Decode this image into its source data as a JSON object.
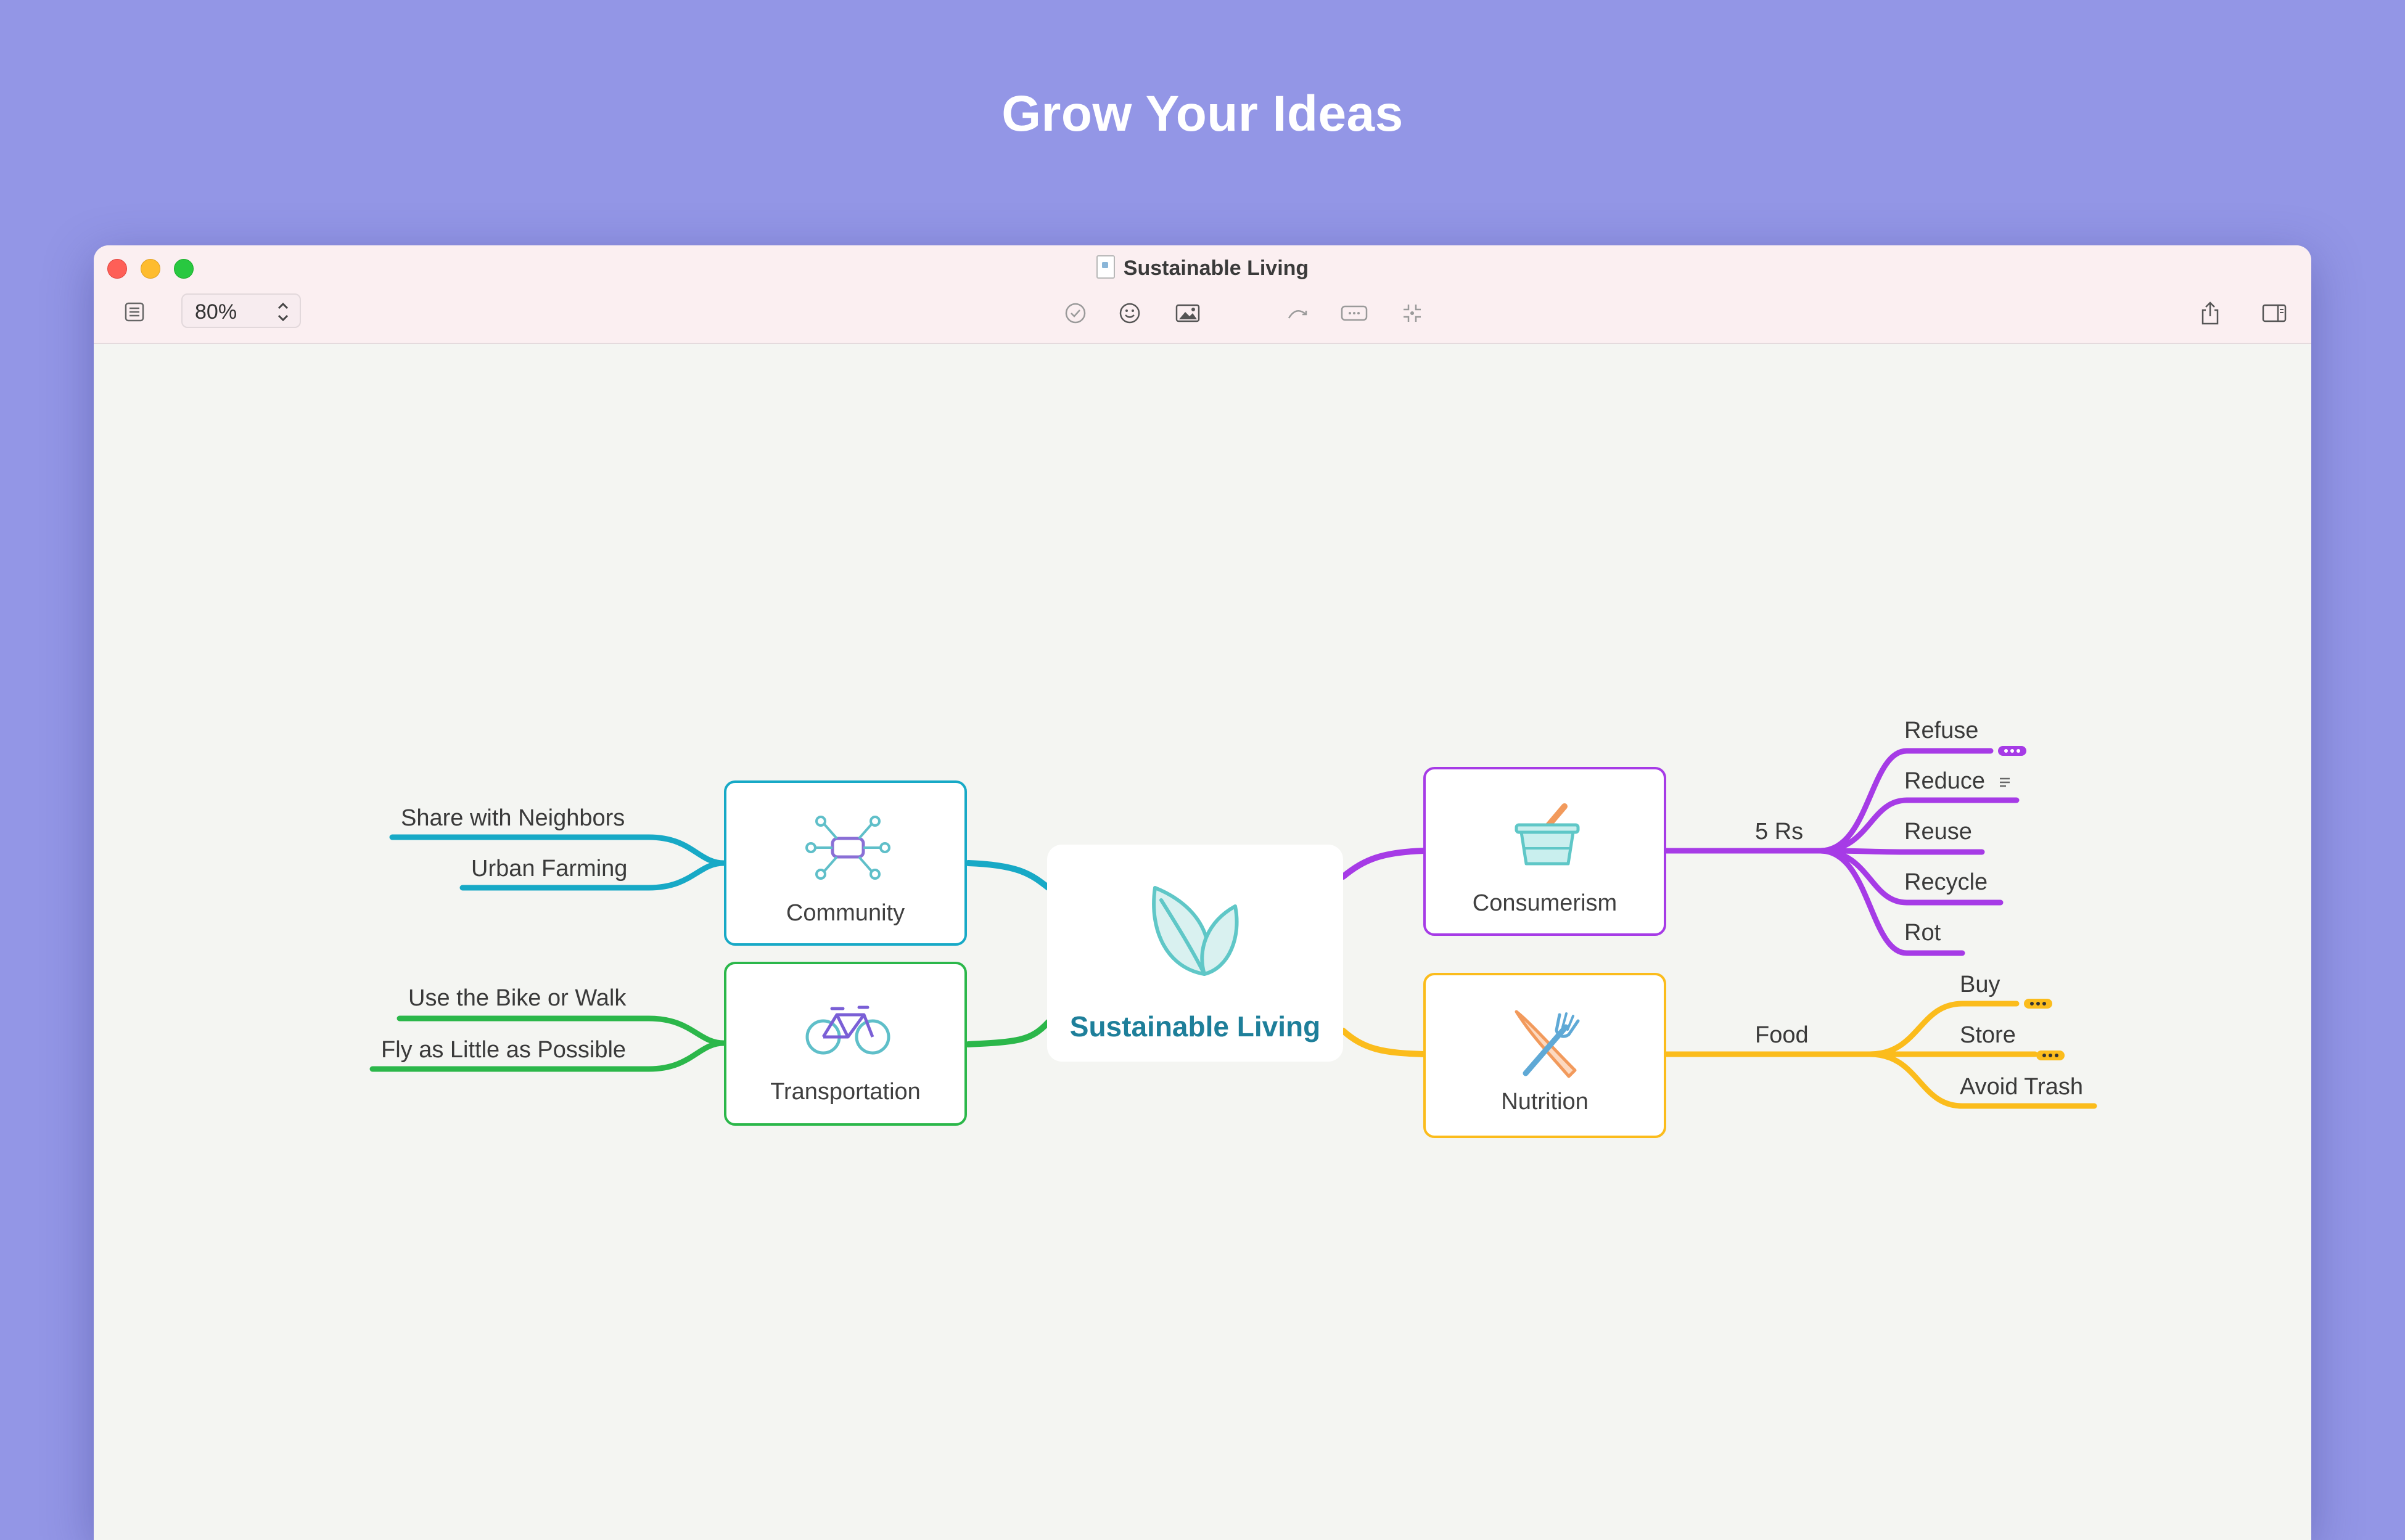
{
  "headline": "Grow Your Ideas",
  "window": {
    "title": "Sustainable Living",
    "zoom": "80%"
  },
  "toolbar": {
    "left": [
      "outline-icon"
    ],
    "center": [
      "checkbox-icon",
      "emoji-icon",
      "image-icon",
      "relation-arrow-icon",
      "callout-icon",
      "focus-icon"
    ],
    "right": [
      "share-icon",
      "sidebar-icon"
    ]
  },
  "mindmap": {
    "central": {
      "label": "Sustainable Living",
      "icon": "leaf-icon",
      "color": "#1e7f9a"
    },
    "topics": [
      {
        "id": "community",
        "label": "Community",
        "icon": "network-icon",
        "color": "#17a9c6",
        "children": [
          "Share with Neighbors",
          "Urban Farming"
        ]
      },
      {
        "id": "transportation",
        "label": "Transportation",
        "icon": "bicycle-icon",
        "color": "#2bb74a",
        "children": [
          "Use the Bike or Walk",
          "Fly as Little as Possible"
        ]
      },
      {
        "id": "consumerism",
        "label": "Consumerism",
        "icon": "basket-icon",
        "color": "#a63be6",
        "sub": "5 Rs",
        "children": [
          "Refuse",
          "Reduce",
          "Reuse",
          "Recycle",
          "Rot"
        ]
      },
      {
        "id": "nutrition",
        "label": "Nutrition",
        "icon": "fork-knife-icon",
        "color": "#fbbc1c",
        "sub": "Food",
        "children": [
          "Buy",
          "Store",
          "Avoid Trash"
        ]
      }
    ]
  }
}
